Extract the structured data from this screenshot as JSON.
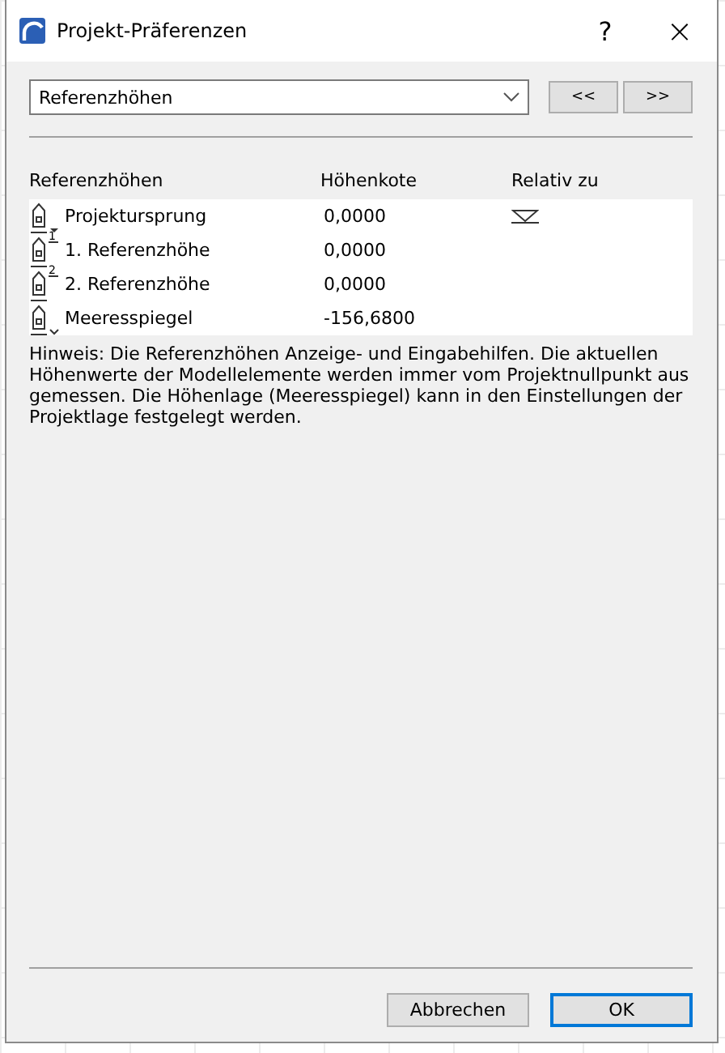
{
  "window": {
    "title": "Projekt-Präferenzen",
    "help": "?",
    "close": "×"
  },
  "panel_select": {
    "value": "Referenzhöhen",
    "prev": "<<",
    "next": ">>"
  },
  "table": {
    "columns": [
      "Referenzhöhen",
      "Höhenkote",
      "Relativ zu"
    ],
    "rows": [
      {
        "kind": "origin",
        "name": "Projektursprung",
        "value": "0,0000",
        "relative_marker": true
      },
      {
        "kind": "reference",
        "number": "1",
        "name": "1. Referenzhöhe",
        "value": "0,0000",
        "relative_marker": false
      },
      {
        "kind": "reference",
        "number": "2",
        "name": "2. Referenzhöhe",
        "value": "0,0000",
        "relative_marker": false
      },
      {
        "kind": "sea",
        "name": "Meeresspiegel",
        "value": "-156,6800",
        "relative_marker": false
      }
    ]
  },
  "note": "Hinweis: Die Referenzhöhen Anzeige- und Eingabehilfen. Die aktuellen Höhenwerte der Modellelemente werden immer vom Projektnullpunkt aus gemessen. Die Höhenlage (Meeresspiegel) kann in den Einstellungen der Projektlage festgelegt werden.",
  "buttons": [
    {
      "label": "Abbrechen",
      "default": false
    },
    {
      "label": "OK",
      "default": true
    }
  ]
}
